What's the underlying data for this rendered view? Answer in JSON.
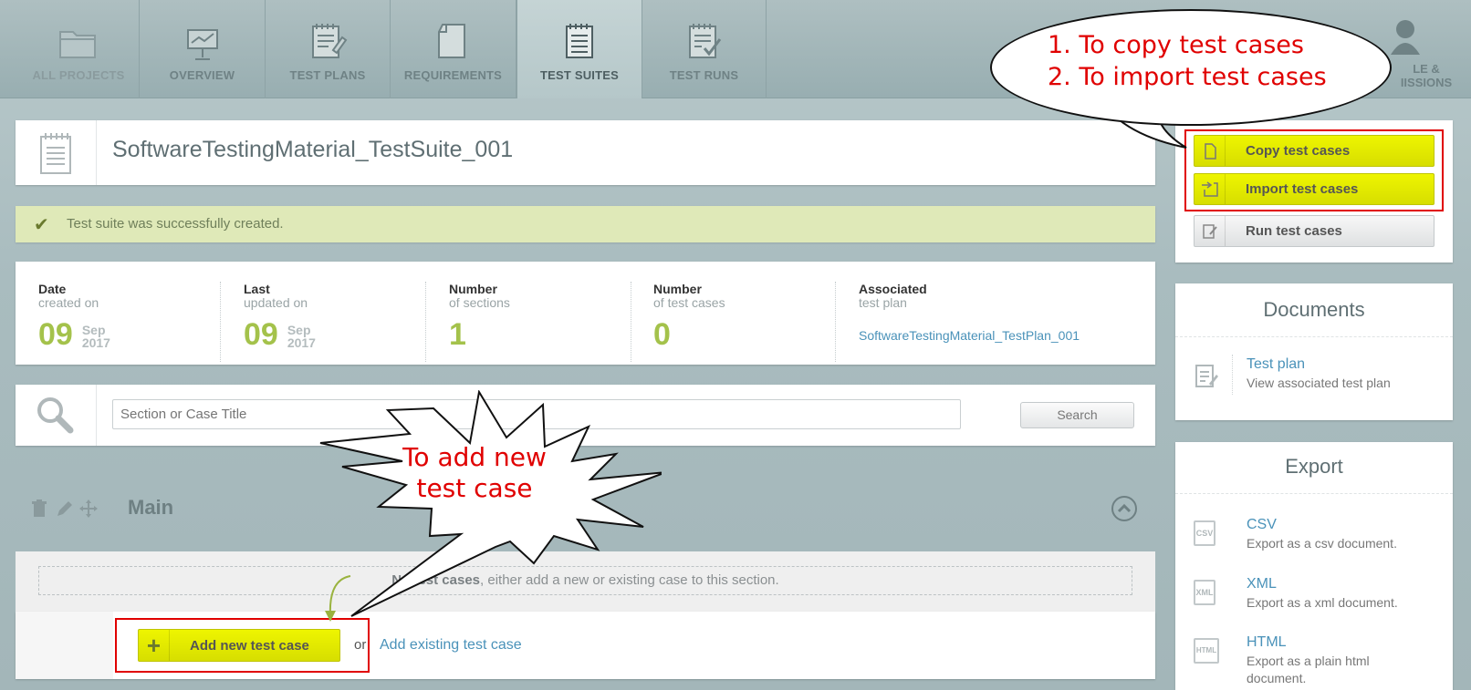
{
  "nav": {
    "tabs": [
      {
        "label": "ALL PROJECTS",
        "icon": "folder-icon"
      },
      {
        "label": "OVERVIEW",
        "icon": "presentation-icon"
      },
      {
        "label": "TEST PLANS",
        "icon": "notepad-pencil-icon"
      },
      {
        "label": "REQUIREMENTS",
        "icon": "document-icon"
      },
      {
        "label": "TEST SUITES",
        "icon": "notepad-icon"
      },
      {
        "label": "TEST RUNS",
        "icon": "notepad-check-icon"
      }
    ],
    "partial_tab_line1": "LE &",
    "partial_tab_line2": "IISSIONS"
  },
  "suite": {
    "title": "SoftwareTestingMaterial_TestSuite_001"
  },
  "alert": {
    "message": "Test suite was successfully created."
  },
  "stats": {
    "date": {
      "t1": "Date",
      "t2": "created on",
      "day": "09",
      "month": "Sep",
      "year": "2017"
    },
    "last": {
      "t1": "Last",
      "t2": "updated on",
      "day": "09",
      "month": "Sep",
      "year": "2017"
    },
    "sections": {
      "t1": "Number",
      "t2": "of sections",
      "value": "1"
    },
    "cases": {
      "t1": "Number",
      "t2": "of test cases",
      "value": "0"
    },
    "plan": {
      "t1": "Associated",
      "t2": "test plan",
      "link": "SoftwareTestingMaterial_TestPlan_001"
    }
  },
  "search": {
    "placeholder": "Section or Case Title",
    "button": "Search"
  },
  "section": {
    "name": "Main",
    "empty_bold": "No test cases",
    "empty_rest": ", either add a new or existing case to this section.",
    "add_new": "Add new test case",
    "or": "or",
    "add_existing": "Add existing test case"
  },
  "actions": {
    "copy": "Copy test cases",
    "import": "Import test cases",
    "run": "Run test cases"
  },
  "documents": {
    "title": "Documents",
    "items": [
      {
        "link": "Test plan",
        "desc": "View associated test plan"
      }
    ]
  },
  "export": {
    "title": "Export",
    "items": [
      {
        "link": "CSV",
        "desc": "Export as a csv document.",
        "icon_text": "CSV"
      },
      {
        "link": "XML",
        "desc": "Export as a xml document.",
        "icon_text": "XML"
      },
      {
        "link": "HTML",
        "desc": "Export as a plain html document.",
        "icon_text": "HTML"
      }
    ]
  },
  "annotations": {
    "oval_line1": "1. To copy test cases",
    "oval_line2": "2. To import test cases",
    "star_line1": "To add new",
    "star_line2": "test case"
  },
  "colors": {
    "accent_green": "#a4c24b",
    "highlight_yellow": "#e8ee00",
    "annotation_red": "#e00000",
    "link_blue": "#4a92b9",
    "alert_bg": "#dfe9b8"
  }
}
